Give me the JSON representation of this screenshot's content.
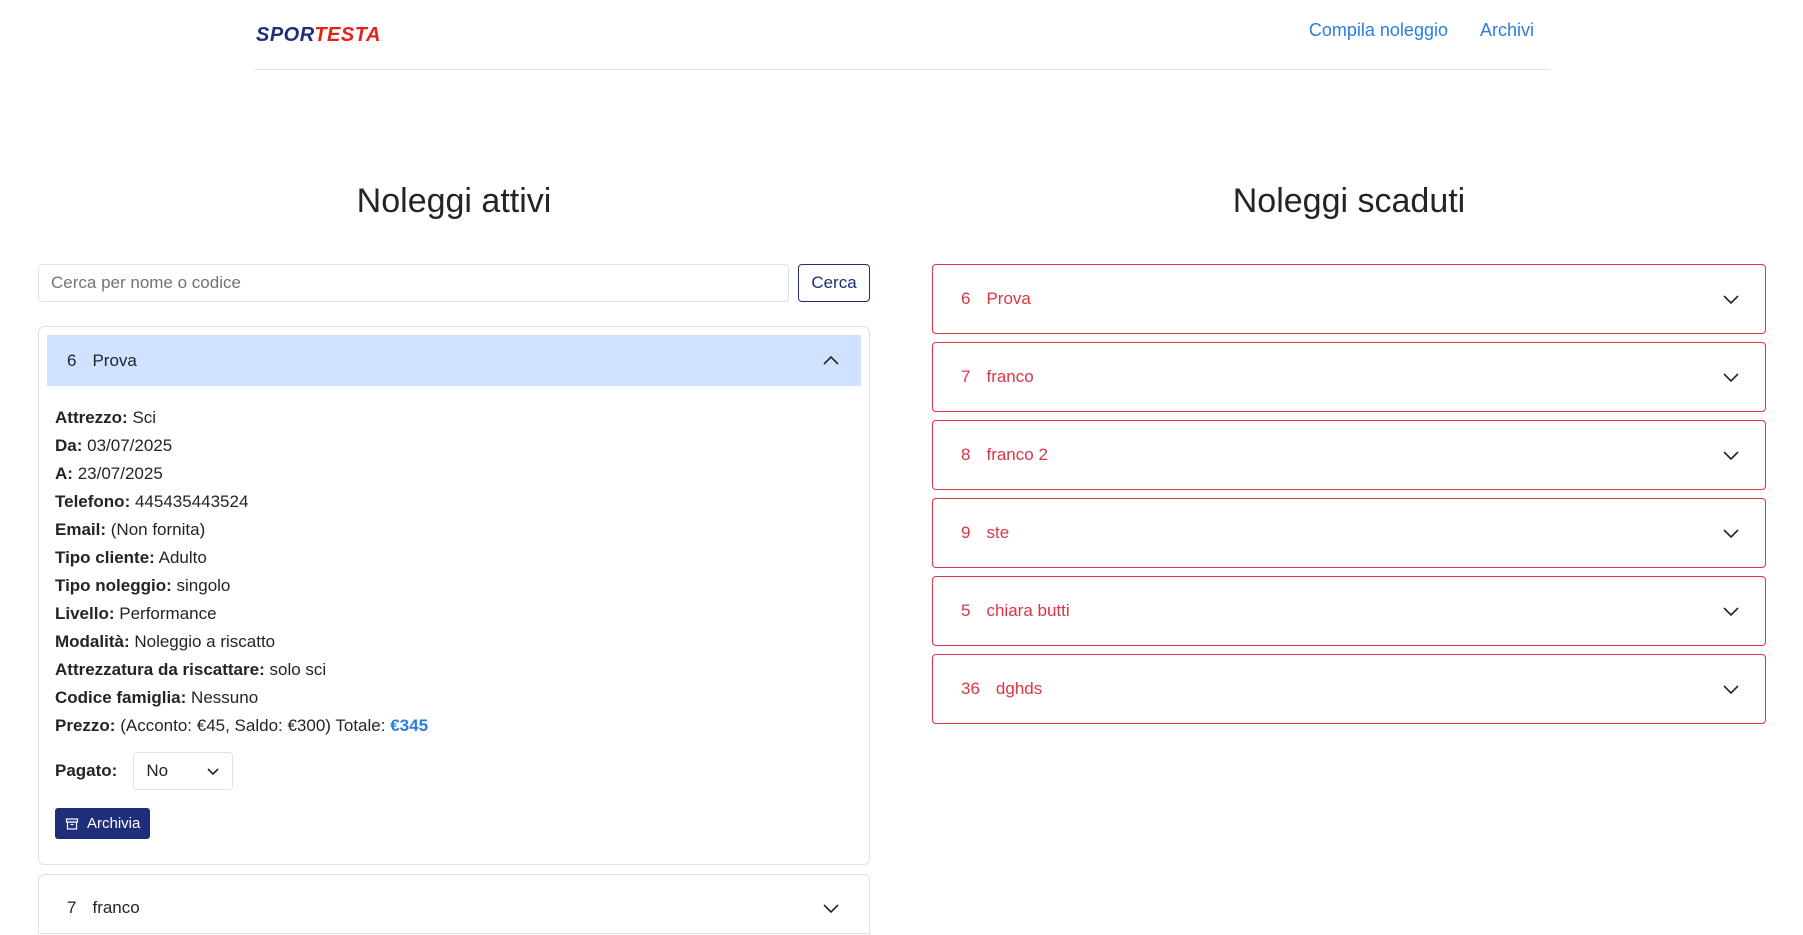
{
  "header": {
    "logo": {
      "part1": "SPOR",
      "part2": "TESTA"
    },
    "nav": [
      "Compila noleggio",
      "Archivi"
    ]
  },
  "active": {
    "title": "Noleggi attivi",
    "search": {
      "placeholder": "Cerca per nome o codice",
      "value": "",
      "button": "Cerca"
    },
    "open_item": {
      "num": "6",
      "name": "Prova",
      "fields": [
        {
          "label": "Attrezzo:",
          "value": "Sci"
        },
        {
          "label": "Da:",
          "value": "03/07/2025"
        },
        {
          "label": "A:",
          "value": "23/07/2025"
        },
        {
          "label": "Telefono:",
          "value": "445435443524"
        },
        {
          "label": "Email:",
          "value": "(Non fornita)"
        },
        {
          "label": "Tipo cliente:",
          "value": "Adulto"
        },
        {
          "label": "Tipo noleggio:",
          "value": "singolo"
        },
        {
          "label": "Livello:",
          "value": "Performance"
        },
        {
          "label": "Modalità:",
          "value": "Noleggio a riscatto"
        },
        {
          "label": "Attrezzatura da riscattare:",
          "value": "solo sci"
        },
        {
          "label": "Codice famiglia:",
          "value": "Nessuno"
        }
      ],
      "price": {
        "label": "Prezzo:",
        "detail": "(Acconto: €45, Saldo: €300) Totale:",
        "total": "€345"
      },
      "paid": {
        "label": "Pagato:",
        "value": "No"
      },
      "archive_button": "Archivia"
    },
    "next_item": {
      "num": "7",
      "name": "franco"
    }
  },
  "expired": {
    "title": "Noleggi scaduti",
    "items": [
      {
        "num": "6",
        "name": "Prova"
      },
      {
        "num": "7",
        "name": "franco"
      },
      {
        "num": "8",
        "name": "franco 2"
      },
      {
        "num": "9",
        "name": "ste"
      },
      {
        "num": "5",
        "name": "chiara butti"
      },
      {
        "num": "36",
        "name": "dghds"
      }
    ]
  },
  "colors": {
    "brand": "#1f2e7a",
    "link": "#2a7de1",
    "expired": "#dc3545",
    "open_header": "#cfe2ff"
  }
}
